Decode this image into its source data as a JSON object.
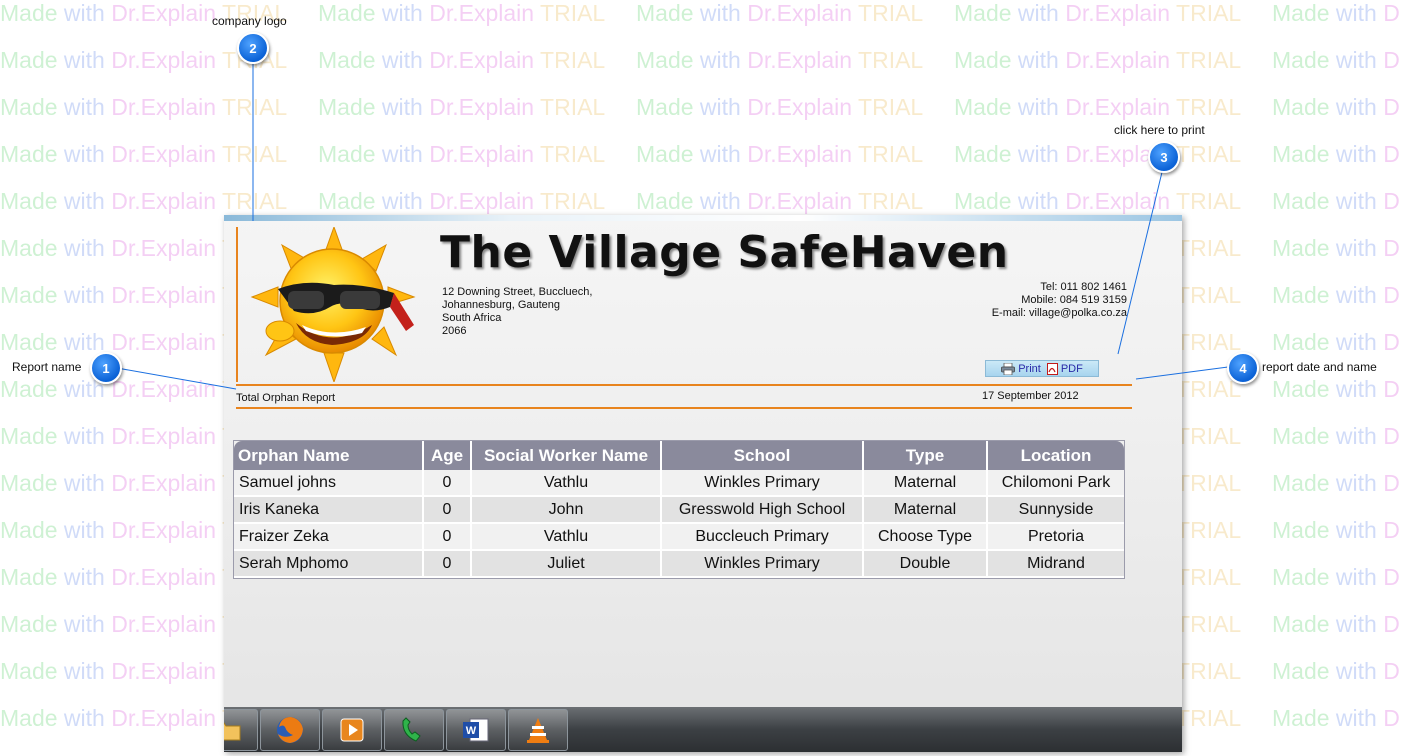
{
  "watermark": {
    "w1": "Made",
    "w2": "with",
    "w3": "Dr.Explain",
    "w4": "TRIAL"
  },
  "callouts": [
    {
      "number": "1",
      "label": "Report name"
    },
    {
      "number": "2",
      "label": "company logo"
    },
    {
      "number": "3",
      "label": "click here to print"
    },
    {
      "number": "4",
      "label": "report date and name"
    }
  ],
  "header": {
    "title": "The Village SafeHaven",
    "address": [
      "12 Downing Street, Buccluech,",
      "Johannesburg, Gauteng",
      "South Africa",
      "2066"
    ],
    "contact": [
      "Tel: 011  802  1461",
      "Mobile: 084 519 3159",
      "E-mail: village@polka.co.za"
    ],
    "print_label": "Print",
    "pdf_label": "PDF"
  },
  "report": {
    "name": "Total Orphan Report",
    "date": "17 September 2012"
  },
  "table": {
    "columns": [
      "Orphan Name",
      "Age",
      "Social Worker Name",
      "School",
      "Type",
      "Location"
    ],
    "rows": [
      [
        "Samuel  johns",
        "0",
        "Vathlu",
        "Winkles Primary",
        "Maternal",
        "Chilomoni Park"
      ],
      [
        "Iris  Kaneka",
        "0",
        "John",
        "Gresswold High School",
        "Maternal",
        "Sunnyside"
      ],
      [
        "Fraizer  Zeka",
        "0",
        "Vathlu",
        "Buccleuch Primary",
        "Choose Type",
        "Pretoria"
      ],
      [
        "Serah  Mphomo",
        "0",
        "Juliet",
        "Winkles Primary",
        "Double",
        "Midrand"
      ]
    ]
  },
  "taskbar": {
    "items": [
      "folder-icon",
      "firefox-icon",
      "media-player-icon",
      "phone-icon",
      "word-icon",
      "vlc-icon"
    ]
  }
}
